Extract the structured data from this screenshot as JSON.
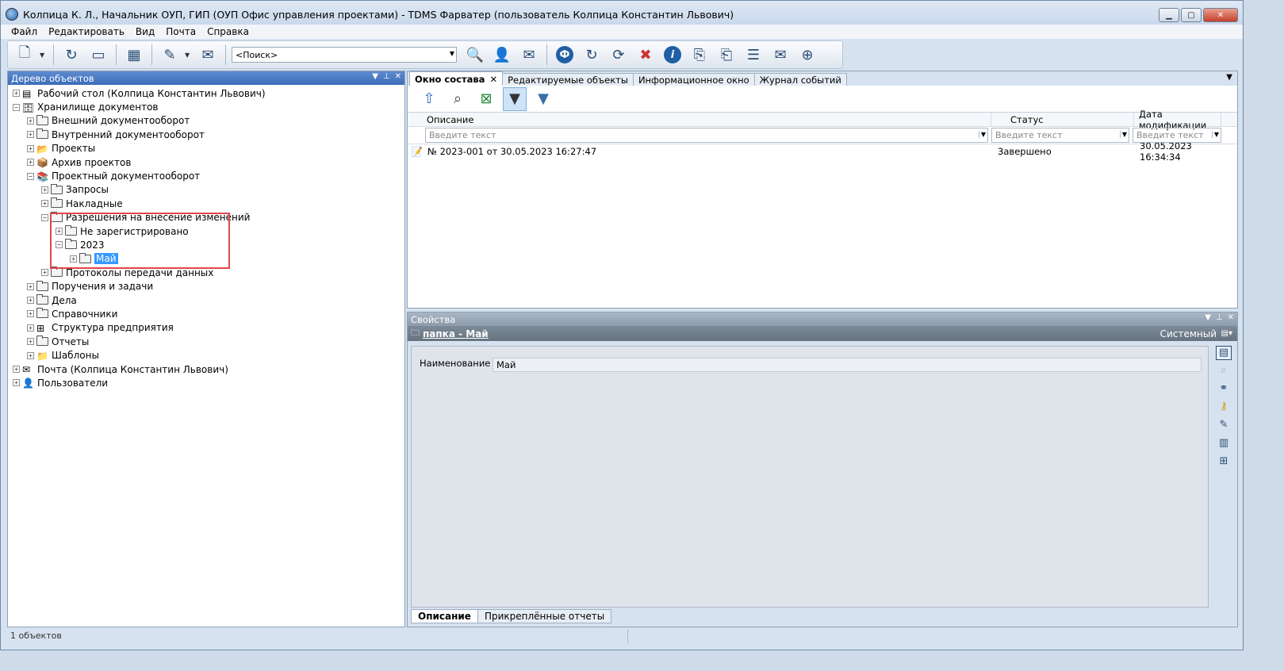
{
  "window": {
    "title": "Колпица К. Л., Начальник ОУП, ГИП (ОУП Офис управления проектами) - TDMS Фарватер (пользователь Колпица Константин Львович)"
  },
  "menu": [
    "Файл",
    "Редактировать",
    "Вид",
    "Почта",
    "Справка"
  ],
  "toolbar": {
    "search_placeholder": "<Поиск>"
  },
  "left_panel": {
    "title": "Дерево объектов",
    "status": "1 объектов",
    "tree": [
      {
        "label": "Рабочий стол (Колпица Константин Львович)",
        "level": 0,
        "exp": "+",
        "icon": "desktop-icon",
        "glyph": "▤"
      },
      {
        "label": "Хранилище документов",
        "level": 0,
        "exp": "−",
        "icon": "storage-icon",
        "glyph": "🗄"
      },
      {
        "label": "Внешний документооборот",
        "level": 1,
        "exp": "+",
        "icon": "folder-icon"
      },
      {
        "label": "Внутренний документооборот",
        "level": 1,
        "exp": "+",
        "icon": "folder-icon"
      },
      {
        "label": "Проекты",
        "level": 1,
        "exp": "+",
        "icon": "projects-icon",
        "glyph": "📂"
      },
      {
        "label": "Архив проектов",
        "level": 1,
        "exp": "+",
        "icon": "archive-icon",
        "glyph": "📦"
      },
      {
        "label": "Проектный документооборот",
        "level": 1,
        "exp": "−",
        "icon": "books-icon",
        "glyph": "📚"
      },
      {
        "label": "Запросы",
        "level": 2,
        "exp": "+",
        "icon": "folder-icon"
      },
      {
        "label": "Накладные",
        "level": 2,
        "exp": "+",
        "icon": "folder-icon"
      },
      {
        "label": "Разрешения на внесение изменений",
        "level": 2,
        "exp": "−",
        "icon": "folder-icon"
      },
      {
        "label": "Не зарегистрировано",
        "level": 3,
        "exp": "+",
        "icon": "folder-icon"
      },
      {
        "label": "2023",
        "level": 3,
        "exp": "−",
        "icon": "folder-icon"
      },
      {
        "label": "Май",
        "level": 4,
        "exp": "+",
        "icon": "folder-icon",
        "selected": true
      },
      {
        "label": "Протоколы передачи данных",
        "level": 2,
        "exp": "+",
        "icon": "folder-icon"
      },
      {
        "label": "Поручения и задачи",
        "level": 1,
        "exp": "+",
        "icon": "folder-icon"
      },
      {
        "label": "Дела",
        "level": 1,
        "exp": "+",
        "icon": "folder-icon"
      },
      {
        "label": "Справочники",
        "level": 1,
        "exp": "+",
        "icon": "folder-icon"
      },
      {
        "label": "Структура предприятия",
        "level": 1,
        "exp": "+",
        "icon": "structure-icon",
        "glyph": "⊞"
      },
      {
        "label": "Отчеты",
        "level": 1,
        "exp": "+",
        "icon": "folder-icon"
      },
      {
        "label": "Шаблоны",
        "level": 1,
        "exp": "+",
        "icon": "templates-icon",
        "glyph": "📁"
      },
      {
        "label": "Почта (Колпица Константин Львович)",
        "level": 0,
        "exp": "+",
        "icon": "mail-icon",
        "glyph": "✉"
      },
      {
        "label": "Пользователи",
        "level": 0,
        "exp": "+",
        "icon": "users-icon",
        "glyph": "👤"
      }
    ]
  },
  "right_tabs": [
    {
      "label": "Окно состава",
      "active": true
    },
    {
      "label": "Редактируемые объекты",
      "active": false
    },
    {
      "label": "Информационное окно",
      "active": false
    },
    {
      "label": "Журнал событий",
      "active": false
    }
  ],
  "grid": {
    "columns": [
      "Описание",
      "Статус",
      "Дата модификации"
    ],
    "filter_placeholder": "Введите текст",
    "rows": [
      {
        "description": "№ 2023-001 от  30.05.2023 16:27:47",
        "status": "Завершено",
        "modified": "30.05.2023 16:34:34"
      }
    ]
  },
  "properties": {
    "title": "Свойства",
    "object_link": "папка - Май",
    "mode": "Системный",
    "field_label": "Наименование",
    "field_value": "Май",
    "tabs": [
      "Описание",
      "Прикреплённые отчеты"
    ]
  }
}
